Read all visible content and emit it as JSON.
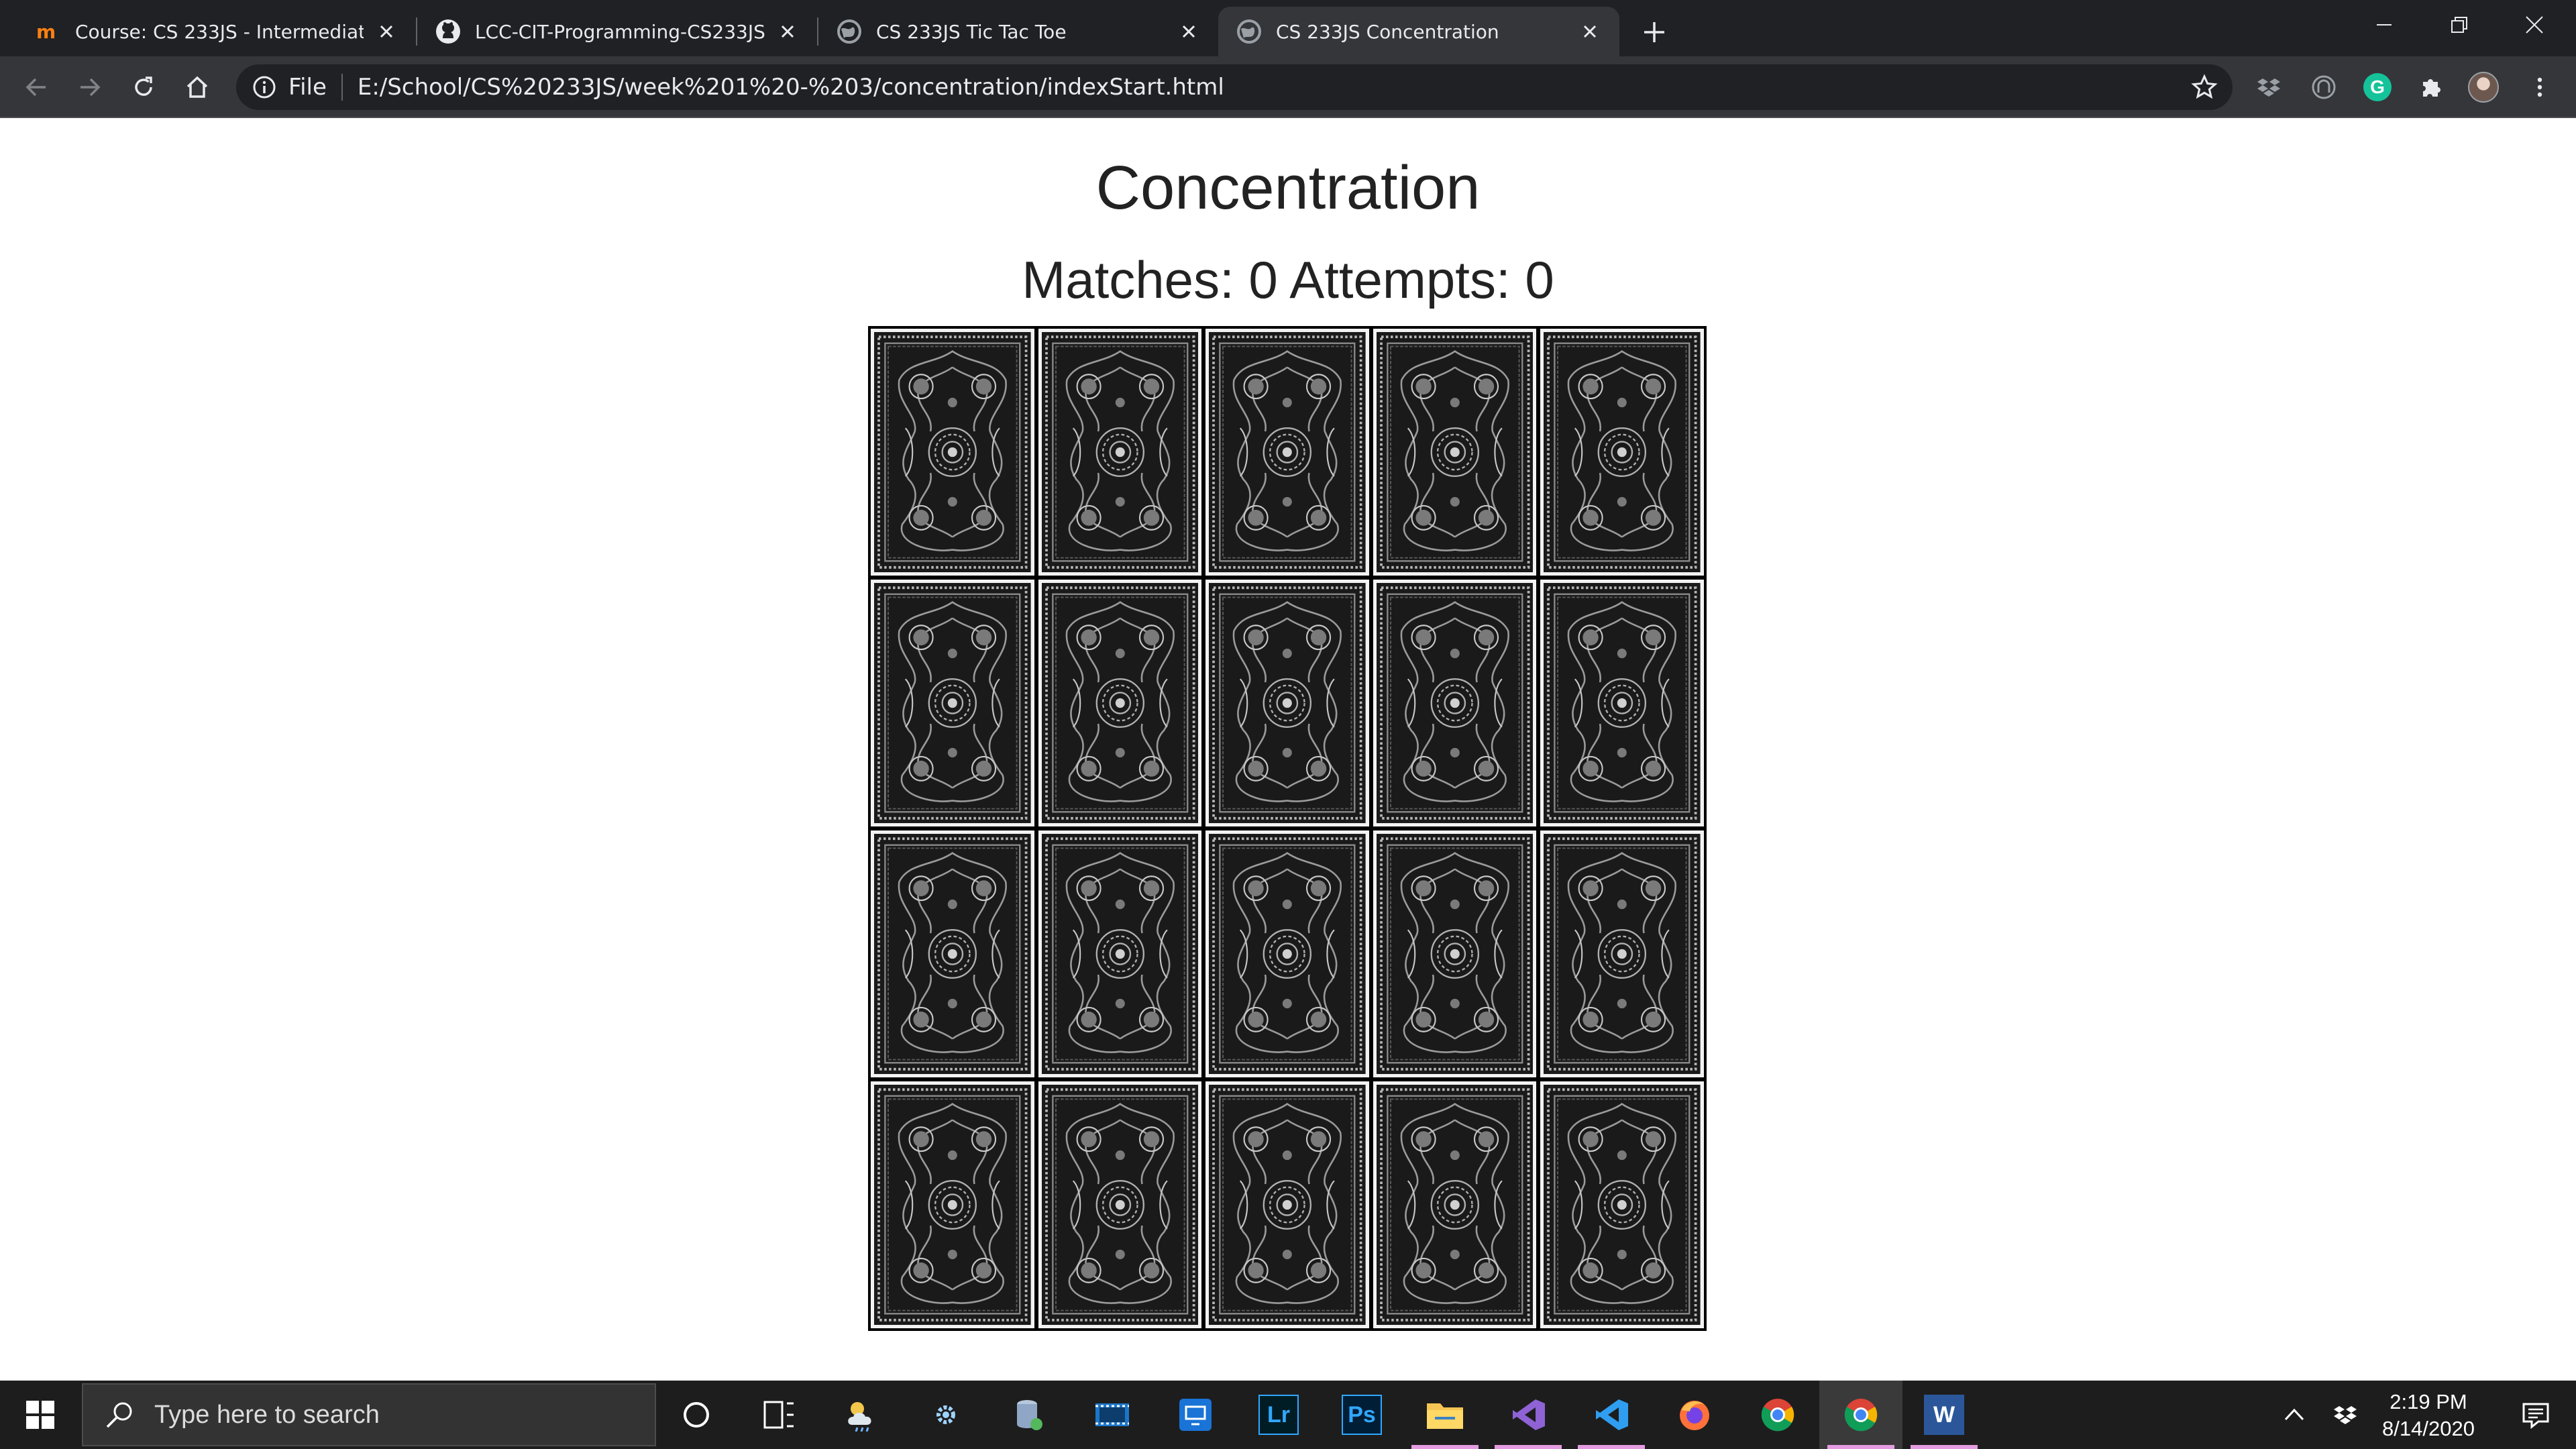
{
  "browser": {
    "tabs": [
      {
        "title": "Course: CS 233JS - Intermediate",
        "favicon": "moodle-icon"
      },
      {
        "title": "LCC-CIT-Programming-CS233JS/",
        "favicon": "github-icon"
      },
      {
        "title": "CS 233JS Tic Tac Toe",
        "favicon": "globe-icon"
      },
      {
        "title": "CS 233JS Concentration",
        "favicon": "globe-icon",
        "active": true
      }
    ],
    "address": {
      "scheme_label": "File",
      "url": "E:/School/CS%20233JS/week%201%20-%203/concentration/indexStart.html"
    }
  },
  "page": {
    "title": "Concentration",
    "status": {
      "matches_label": "Matches:",
      "matches": "0",
      "attempts_label": "Attempts:",
      "attempts": "0"
    },
    "board": {
      "rows": 4,
      "columns": 5,
      "card_state": "face-down"
    }
  },
  "taskbar": {
    "search_placeholder": "Type here to search",
    "apps": [
      "cortana-icon",
      "task-view-icon",
      "weather-icon",
      "settings-icon",
      "database-icon",
      "video-editor-icon",
      "remote-desktop-icon",
      "lightroom-icon",
      "photoshop-icon",
      "file-explorer-icon",
      "visual-studio-icon",
      "vscode-icon",
      "firefox-icon",
      "chrome-icon",
      "chrome-icon",
      "word-icon"
    ],
    "app_labels": {
      "lightroom": "Lr",
      "photoshop": "Ps",
      "word": "W"
    },
    "clock": {
      "time": "2:19 PM",
      "date": "8/14/2020"
    }
  },
  "colors": {
    "tabstrip": "#202124",
    "toolbar": "#35363a",
    "taskbar": "#1d1d1d",
    "running_indicator": "#e59be2"
  }
}
